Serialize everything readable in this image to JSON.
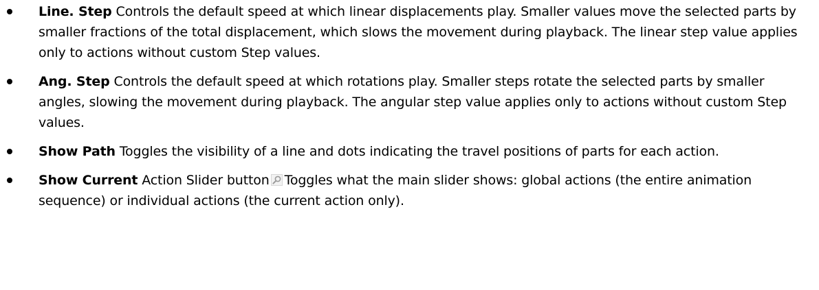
{
  "items": [
    {
      "term": "Line. Step",
      "text": "Controls the default speed at which linear displacements play. Smaller values move the selected parts by smaller fractions of the total displacement, which slows the movement during playback. The linear step value applies only to actions without custom Step values."
    },
    {
      "term": "Ang. Step",
      "text": "Controls the default speed at which rotations play. Smaller steps rotate the selected parts by smaller angles, slowing the movement during playback. The angular step value applies only to actions without custom Step values."
    },
    {
      "term": "Show Path",
      "text": "Toggles the visibility of a line and dots indicating the travel positions of parts for each action."
    },
    {
      "term": "Show Current",
      "text_before_icon": "Action Slider button",
      "icon": "magnifier-icon",
      "text": "Toggles what the main slider shows: global actions (the entire animation sequence) or individual actions (the current action only)."
    }
  ]
}
